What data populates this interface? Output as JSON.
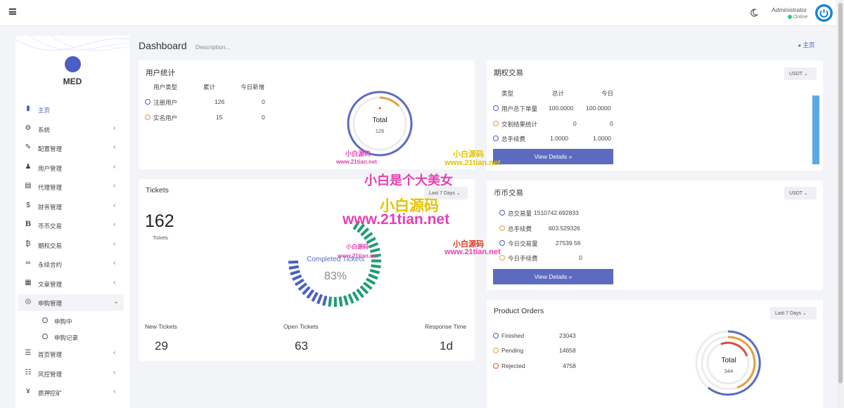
{
  "topbar": {
    "admin_name": "Administrator",
    "admin_status": "Online",
    "menu_icon": "hamburger-icon",
    "theme_icon": "moon-icon",
    "power_icon": "power-icon"
  },
  "sidebar": {
    "logo_text": "MED",
    "items": [
      {
        "label": "主页",
        "icon": "bar-chart-icon"
      },
      {
        "label": "系统",
        "icon": "gear-icon"
      },
      {
        "label": "配置管理",
        "icon": "wrench-icon"
      },
      {
        "label": "用户管理",
        "icon": "user-icon"
      },
      {
        "label": "代理管理",
        "icon": "id-card-icon"
      },
      {
        "label": "财务管理",
        "icon": "dollar-icon"
      },
      {
        "label": "币币交易",
        "icon": "bitcoin-b-icon"
      },
      {
        "label": "期权交易",
        "icon": "bitcoin-icon"
      },
      {
        "label": "永续合约",
        "icon": "link-icon"
      },
      {
        "label": "文章管理",
        "icon": "newspaper-icon"
      },
      {
        "label": "申购管理",
        "icon": "lifebuoy-icon"
      },
      {
        "label": "首页管理",
        "icon": "list-icon"
      },
      {
        "label": "风控管理",
        "icon": "list-alt-icon"
      },
      {
        "label": "质押挖矿",
        "icon": "yen-icon"
      }
    ],
    "subitems": [
      {
        "label": "申购中"
      },
      {
        "label": "申购记录"
      }
    ]
  },
  "header": {
    "title": "Dashboard",
    "description": "Description...",
    "breadcrumb": "主页"
  },
  "user_stats": {
    "title": "用户统计",
    "columns": [
      "用户类型",
      "累计",
      "今日新增"
    ],
    "rows": [
      {
        "type": "注册用户",
        "total": "126",
        "today": "0"
      },
      {
        "type": "实名用户",
        "total": "15",
        "today": "0"
      }
    ],
    "donut_label": "Total",
    "donut_value": "126"
  },
  "tickets": {
    "title": "Tickets",
    "period": "Last 7 Days",
    "count": "162",
    "count_label": "Tickets",
    "gauge_label": "Completed Tickets",
    "gauge_value": "83%",
    "gauge_fraction": 0.83,
    "stats": [
      {
        "label": "New Tickets",
        "value": "29"
      },
      {
        "label": "Open Tickets",
        "value": "63"
      },
      {
        "label": "Response Time",
        "value": "1d"
      }
    ]
  },
  "options_trade": {
    "title": "期权交易",
    "currency": "USDT",
    "columns": [
      "类型",
      "总计",
      "今日"
    ],
    "rows": [
      {
        "type": "用户总下单量",
        "total": "100.0000",
        "today": "100.0000"
      },
      {
        "type": "交割结果统计",
        "total": "0",
        "today": "0"
      },
      {
        "type": "总手续费",
        "total": "1.0000",
        "today": "1.0000"
      }
    ],
    "button": "View Details »"
  },
  "coin_trade": {
    "title": "币币交易",
    "currency": "USDT",
    "rows": [
      {
        "label": "总交易量",
        "value": "1510742.692833"
      },
      {
        "label": "总手续费",
        "value": "603.529326"
      },
      {
        "label": "今日交易量",
        "value": "27539.56"
      },
      {
        "label": "今日手续费",
        "value": "0"
      }
    ],
    "button": "View Details »"
  },
  "product_orders": {
    "title": "Product Orders",
    "period": "Last 7 Days",
    "rows": [
      {
        "label": "Finished",
        "value": "23043"
      },
      {
        "label": "Pending",
        "value": "14658"
      },
      {
        "label": "Rejected",
        "value": "4758"
      }
    ],
    "donut_label": "Total",
    "donut_value": "344"
  },
  "watermarks": {
    "w1": "小白源码",
    "w2": "www.21tian.net",
    "w3": "小白源码",
    "w4": "www.21tian.net",
    "w5": "小白是个大美女",
    "w6": "小白源码",
    "w7": "www.21tian.net",
    "w8": "小白源码",
    "w9": "www.21tian.net",
    "w10": "小白源码",
    "w11": "www.21tian.net"
  },
  "colors": {
    "primary": "#4a5fc1",
    "button": "#5c6bc0",
    "orange": "#e5a03b",
    "red": "#e04a4a",
    "green": "#1e9e72",
    "online": "#2ecc71",
    "power": "#1a84d6",
    "watermark_pink": "#e83fb2",
    "watermark_yellow": "#e5c300",
    "watermark_red": "#d93a1f"
  }
}
